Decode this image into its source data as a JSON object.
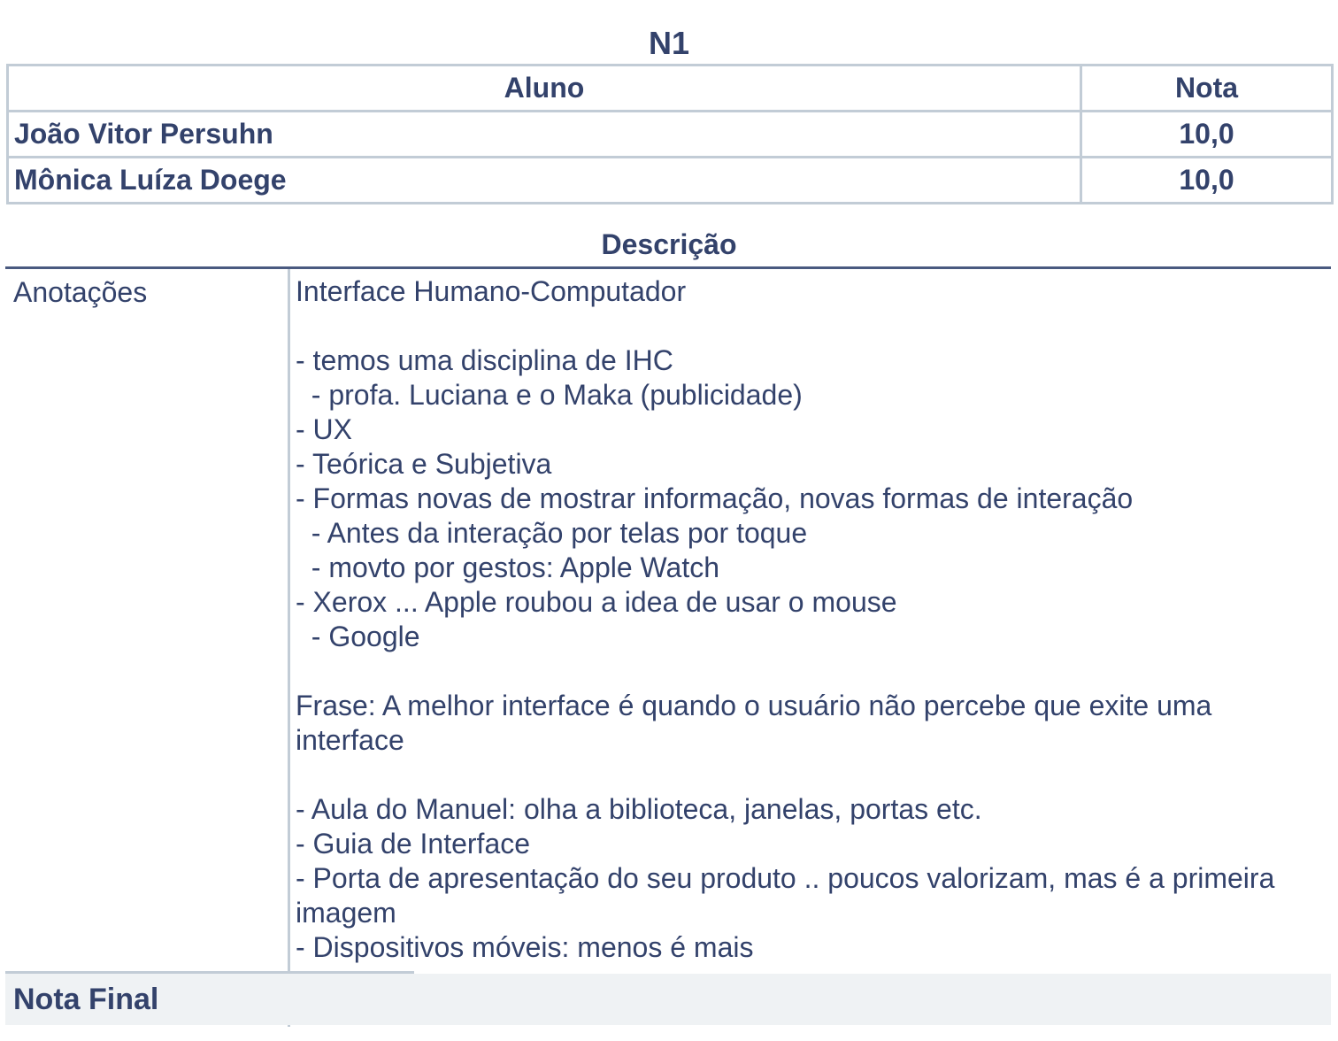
{
  "title": "N1",
  "grades_table": {
    "headers": {
      "student": "Aluno",
      "grade": "Nota"
    },
    "rows": [
      {
        "student": "João Vitor Persuhn",
        "grade": "10,0"
      },
      {
        "student": "Mônica Luíza Doege",
        "grade": "10,0"
      }
    ]
  },
  "description": {
    "title": "Descrição",
    "label": "Anotações",
    "notes": "Interface Humano-Computador\n\n- temos uma disciplina de IHC\n  - profa. Luciana e o Maka (publicidade)\n- UX\n- Teórica e Subjetiva\n- Formas novas de mostrar informação, novas formas de interação\n  - Antes da interação por telas por toque\n  - movto por gestos: Apple Watch\n- Xerox ... Apple roubou a idea de usar o mouse\n  - Google\n\nFrase: A melhor interface é quando o usuário não percebe que exite uma interface\n\n- Aula do Manuel: olha a biblioteca, janelas, portas etc.\n- Guia de Interface\n- Porta de apresentação do seu produto .. poucos valorizam, mas é a primeira imagem\n- Dispositivos móveis: menos é mais"
  },
  "final": {
    "label": "Nota Final",
    "value": ""
  }
}
